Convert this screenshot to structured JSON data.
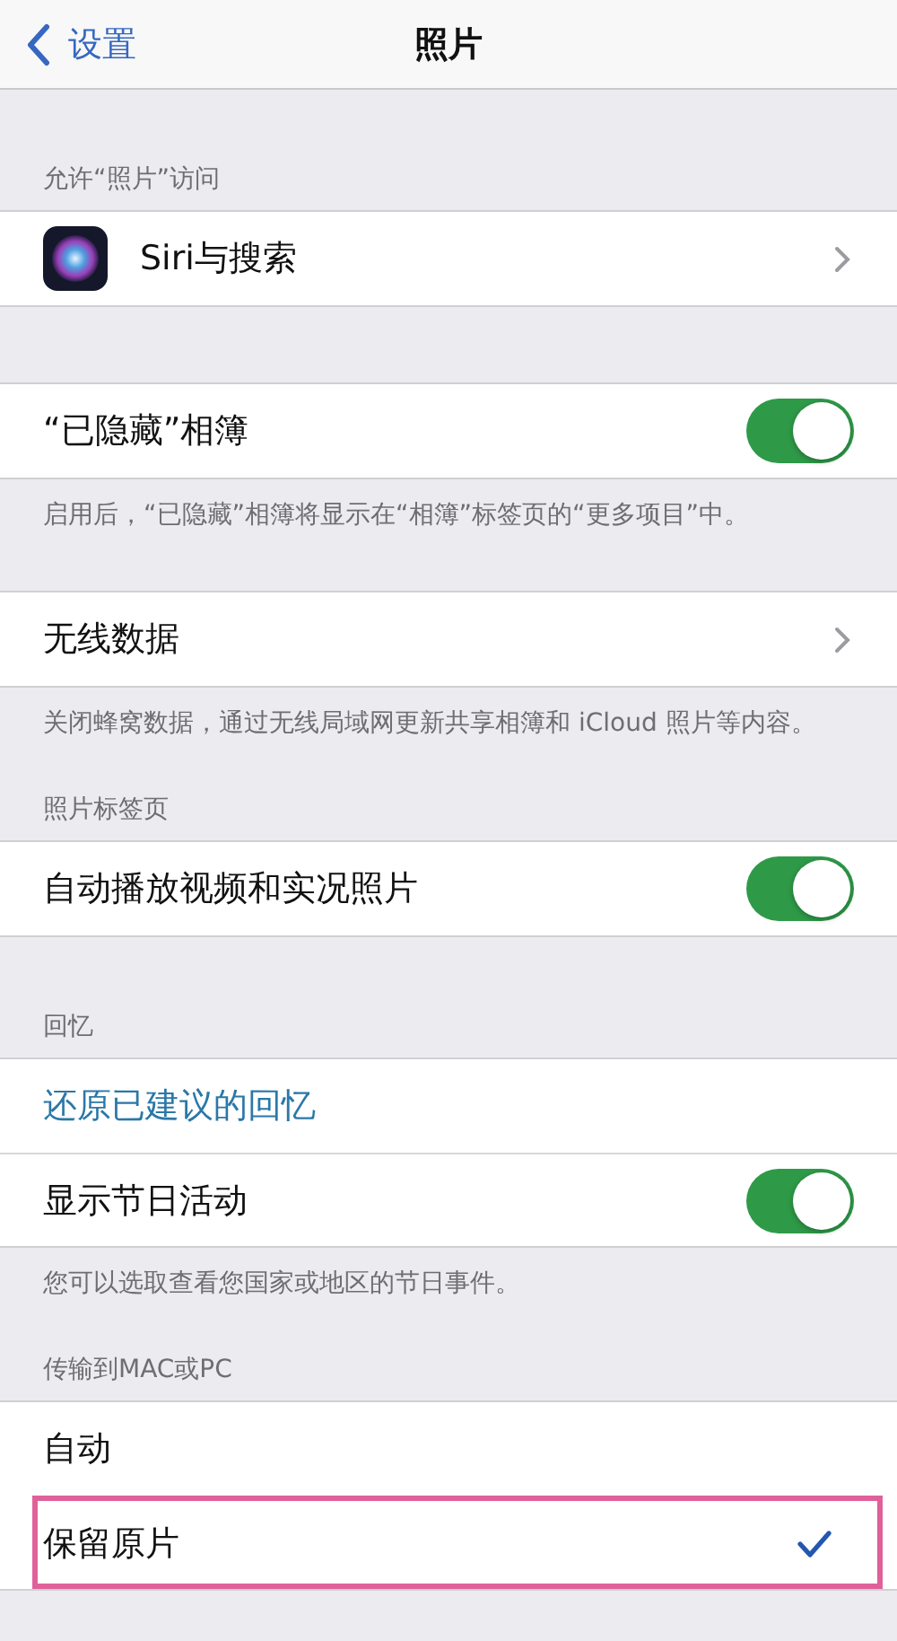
{
  "nav": {
    "back": "设置",
    "title": "照片"
  },
  "sections": [
    {
      "header": "允许“照片”访问",
      "rows": [
        {
          "kind": "app",
          "label": "Siri与搜索"
        }
      ]
    },
    {
      "rows": [
        {
          "kind": "toggle",
          "label": "“已隐藏”相簿",
          "on": true
        }
      ],
      "footer": "启用后，“已隐藏”相簿将显示在“相簿”标签页的“更多项目”中。"
    },
    {
      "rows": [
        {
          "kind": "link",
          "label": "无线数据"
        }
      ],
      "footer": "关闭蜂窝数据，通过无线局域网更新共享相簿和 iCloud 照片等内容。"
    },
    {
      "header": "照片标签页",
      "rows": [
        {
          "kind": "toggle",
          "label": "自动播放视频和实况照片",
          "on": true
        }
      ]
    },
    {
      "header": "回忆",
      "rows": [
        {
          "kind": "action",
          "label": "还原已建议的回忆"
        },
        {
          "kind": "toggle",
          "label": "显示节日活动",
          "on": true
        }
      ],
      "footer": "您可以选取查看您国家或地区的节日事件。"
    },
    {
      "header": "传输到MAC或PC",
      "rows": [
        {
          "kind": "option",
          "label": "自动",
          "selected": false,
          "highlighted": false
        },
        {
          "kind": "option",
          "label": "保留原片",
          "selected": true,
          "highlighted": true
        }
      ]
    }
  ]
}
